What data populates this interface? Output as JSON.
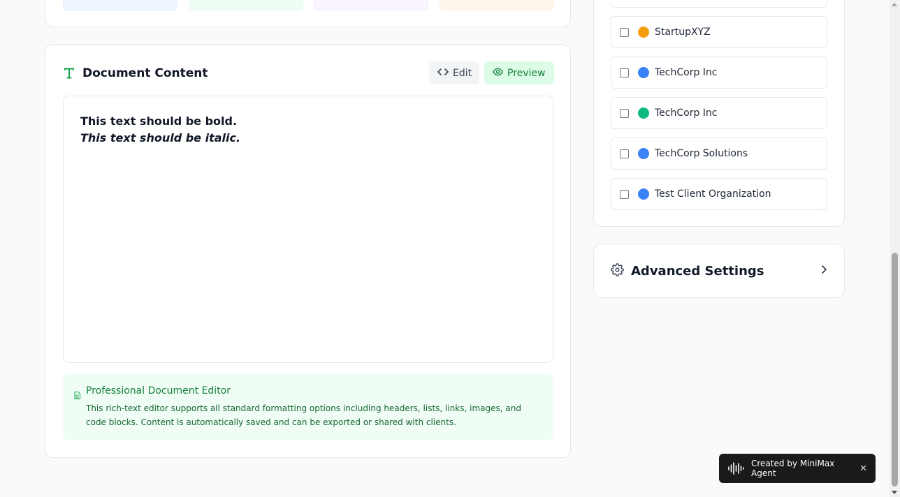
{
  "document": {
    "title": "Document Content",
    "edit_label": "Edit",
    "preview_label": "Preview",
    "content": {
      "bold_line": "This text should be bold.",
      "italic_line": "This text should be italic."
    },
    "info": {
      "title": "Professional Document Editor",
      "text": "This rich-text editor supports all standard formatting options including headers, lists, links, images, and code blocks. Content is automatically saved and can be exported or shared with clients."
    }
  },
  "clients": {
    "items": [
      {
        "name": "StartupXYZ",
        "color": "#f59e0b",
        "checked": false
      },
      {
        "name": "TechCorp Inc",
        "color": "#3b82f6",
        "checked": false
      },
      {
        "name": "TechCorp Inc",
        "color": "#10b981",
        "checked": false
      },
      {
        "name": "TechCorp Solutions",
        "color": "#3b82f6",
        "checked": false
      },
      {
        "name": "Test Client Organization",
        "color": "#3b82f6",
        "checked": false
      }
    ]
  },
  "advanced_settings": {
    "title": "Advanced Settings"
  },
  "toast": {
    "label": "Created by MiniMax Agent",
    "close_glyph": "✕"
  },
  "colors": {
    "accent_green": "#16a34a",
    "primary_text": "#111827"
  }
}
